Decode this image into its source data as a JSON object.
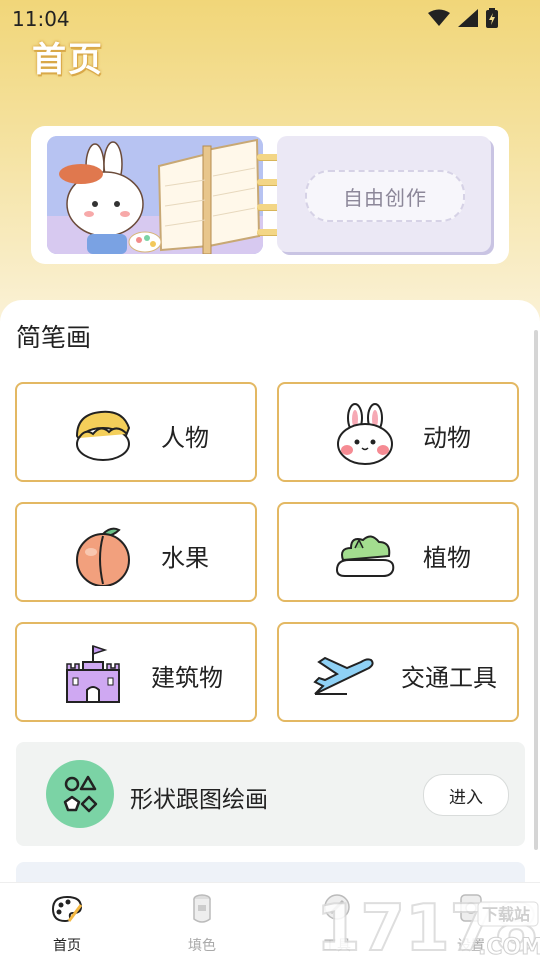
{
  "status_bar": {
    "time": "11:04"
  },
  "header": {
    "title": "首页"
  },
  "banner": {
    "free_create_label": "自由创作"
  },
  "section": {
    "title": "简笔画"
  },
  "categories": [
    {
      "label": "人物",
      "icon": "person-icon"
    },
    {
      "label": "动物",
      "icon": "rabbit-icon"
    },
    {
      "label": "水果",
      "icon": "peach-icon"
    },
    {
      "label": "植物",
      "icon": "plant-icon"
    },
    {
      "label": "建筑物",
      "icon": "castle-icon"
    },
    {
      "label": "交通工具",
      "icon": "airplane-icon"
    }
  ],
  "shape_card": {
    "label": "形状跟图绘画",
    "button": "进入",
    "icon": "shapes-icon"
  },
  "bottom_nav": [
    {
      "label": "首页",
      "icon": "palette-icon",
      "active": true
    },
    {
      "label": "填色",
      "icon": "paint-bucket-icon",
      "active": false
    },
    {
      "label": "工具",
      "icon": "tools-icon",
      "active": false
    },
    {
      "label": "设置",
      "icon": "settings-icon",
      "active": false
    }
  ],
  "watermark": {
    "text": "17178",
    "sub_top": "下载站",
    "sub_bottom": ".COM"
  },
  "colors": {
    "accent_border": "#e3b863",
    "header_gradient_top": "#f1d679",
    "shape_icon_bg": "#7bd3a5"
  }
}
